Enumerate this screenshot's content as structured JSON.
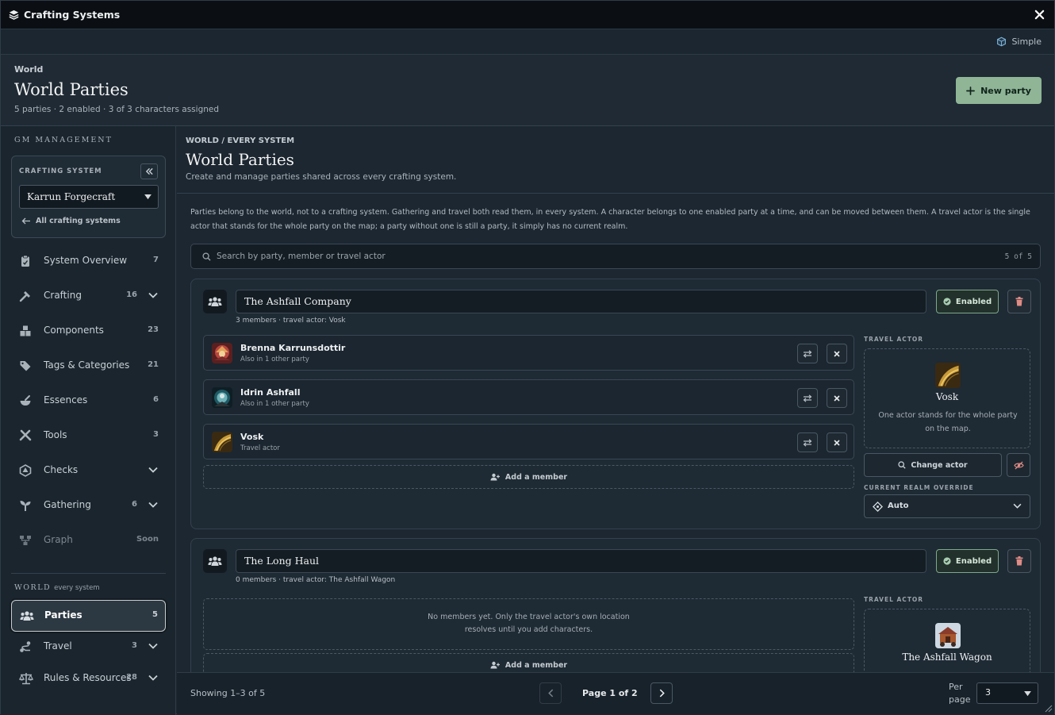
{
  "window": {
    "title": "Crafting Systems",
    "close_icon": "close-icon"
  },
  "modebar": {
    "mode_label": "Simple"
  },
  "header": {
    "eyebrow": "World",
    "title": "World Parties",
    "subtitle": "5 parties · 2 enabled · 3 of 3 characters assigned",
    "new_party_label": "New party"
  },
  "sidebar": {
    "section_label": "GM MANAGEMENT",
    "crafting_system_label": "CRAFTING SYSTEM",
    "crafting_system_value": "Karrun Forgecraft",
    "back_label": "All crafting systems",
    "items": [
      {
        "label": "System Overview",
        "count": "7",
        "icon": "clipboard-icon",
        "chevron": false
      },
      {
        "label": "Crafting",
        "count": "16",
        "icon": "hammer-icon",
        "chevron": true
      },
      {
        "label": "Components",
        "count": "23",
        "icon": "boxes-icon",
        "chevron": false
      },
      {
        "label": "Tags & Categories",
        "count": "21",
        "icon": "tags-icon",
        "chevron": false
      },
      {
        "label": "Essences",
        "count": "6",
        "icon": "mortar-icon",
        "chevron": false
      },
      {
        "label": "Tools",
        "count": "3",
        "icon": "tools-icon",
        "chevron": false
      },
      {
        "label": "Checks",
        "count": "",
        "icon": "dice-icon",
        "chevron": true
      },
      {
        "label": "Gathering",
        "count": "6",
        "icon": "seedling-icon",
        "chevron": true
      },
      {
        "label": "Graph",
        "count": "Soon",
        "icon": "graph-icon",
        "chevron": false
      }
    ],
    "world_label": "WORLD",
    "world_sub": "every system",
    "world_items": [
      {
        "label": "Parties",
        "count": "5",
        "icon": "users-icon",
        "chevron": false
      },
      {
        "label": "Travel",
        "count": "3",
        "icon": "route-icon",
        "chevron": true
      },
      {
        "label": "Rules & Resources",
        "count": "28",
        "icon": "scale-icon",
        "chevron": true
      }
    ]
  },
  "main": {
    "breadcrumb": "WORLD / EVERY SYSTEM",
    "title": "World Parties",
    "description": "Create and manage parties shared across every crafting system.",
    "info": "Parties belong to the world, not to a crafting system. Gathering and travel both read them, in every system. A character belongs to one enabled party at a time, and can be moved between them. A travel actor is the single actor that stands for the whole party on the map; a party without one is still a party, it simply has no current realm.",
    "search_placeholder": "Search by party, member or travel actor",
    "search_count": "5 of 5"
  },
  "parties": [
    {
      "name": "The Ashfall Company",
      "status": "Enabled",
      "meta": "3 members · travel actor: Vosk",
      "members": [
        {
          "name": "Brenna Karrunsdottir",
          "sub": "Also in 1 other party"
        },
        {
          "name": "Idrin Ashfall",
          "sub": "Also in 1 other party"
        },
        {
          "name": "Vosk",
          "sub": "Travel actor"
        }
      ],
      "add_member_label": "Add a member",
      "travel_actor_label": "TRAVEL ACTOR",
      "travel_actor_name": "Vosk",
      "travel_actor_desc": "One actor stands for the whole party on the map.",
      "change_actor_label": "Change actor",
      "realm_label": "CURRENT REALM OVERRIDE",
      "realm_value": "Auto"
    },
    {
      "name": "The Long Haul",
      "status": "Enabled",
      "meta": "0 members · travel actor: The Ashfall Wagon",
      "empty_text_1": "No members yet. Only the travel actor's own location",
      "empty_text_2": "resolves until you add characters.",
      "add_member_label": "Add a member",
      "travel_actor_label": "TRAVEL ACTOR",
      "travel_actor_name": "The Ashfall Wagon"
    }
  ],
  "footer": {
    "showing": "Showing 1–3 of 5",
    "page": "Page 1 of 2",
    "per_page_1": "Per",
    "per_page_2": "page",
    "per_page_value": "3"
  }
}
